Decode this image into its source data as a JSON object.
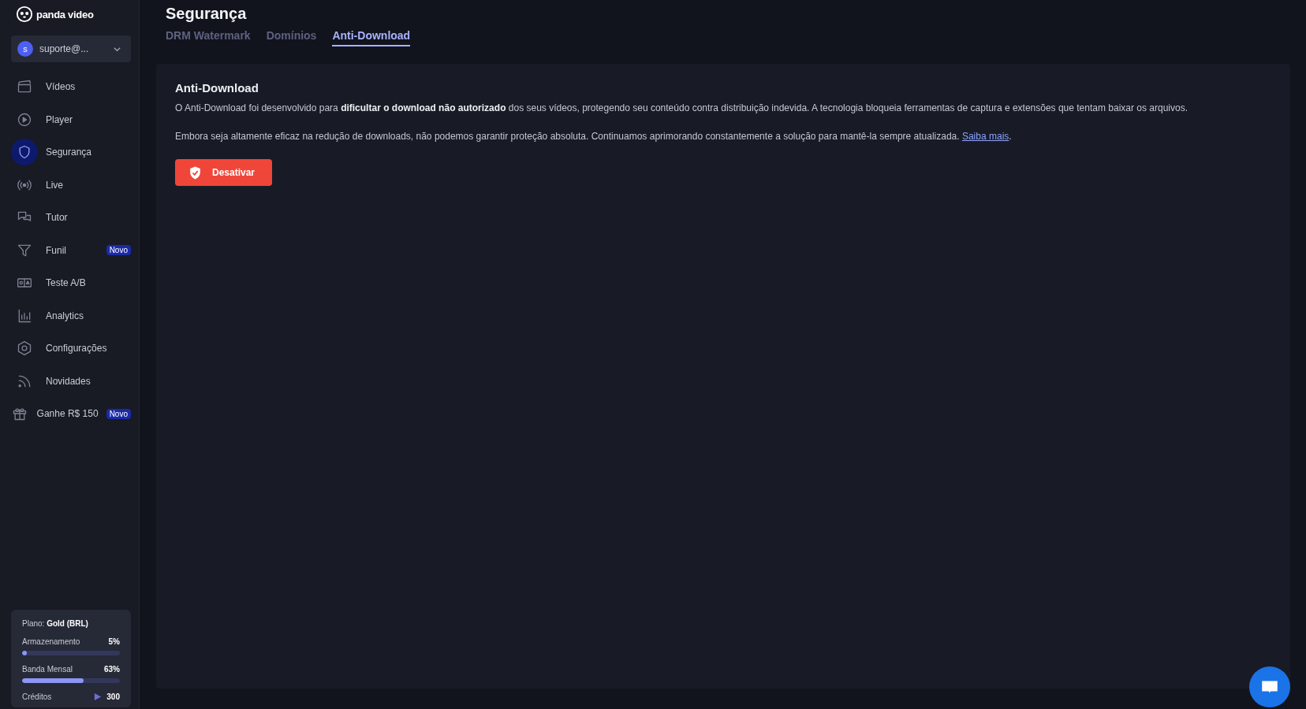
{
  "brand": {
    "name": "panda video"
  },
  "account": {
    "initial": "s",
    "email": "suporte@..."
  },
  "nav": [
    {
      "label": "Vídeos",
      "selected": false
    },
    {
      "label": "Player",
      "selected": false
    },
    {
      "label": "Segurança",
      "selected": true
    },
    {
      "label": "Live",
      "selected": false
    },
    {
      "label": "Tutor",
      "selected": false
    },
    {
      "label": "Funil",
      "selected": false,
      "badge": "Novo"
    },
    {
      "label": "Teste A/B",
      "selected": false
    },
    {
      "label": "Analytics",
      "selected": false
    },
    {
      "label": "Configurações",
      "selected": false
    },
    {
      "label": "Novidades",
      "selected": false
    },
    {
      "label": "Ganhe R$ 150",
      "selected": false,
      "badge": "Novo"
    }
  ],
  "plan": {
    "label": "Plano:",
    "name": "Gold (BRL)",
    "meters": [
      {
        "name": "Armazenamento",
        "reading": "5%",
        "level": 0.05
      },
      {
        "name": "Banda Mensal",
        "reading": "63%",
        "level": 0.63
      }
    ],
    "credits_label": "Créditos",
    "credits": "300"
  },
  "page": {
    "title": "Segurança",
    "tabs": [
      {
        "label": "DRM Watermark",
        "selected": false
      },
      {
        "label": "Domínios",
        "selected": false
      },
      {
        "label": "Anti-Download",
        "selected": true
      }
    ]
  },
  "card": {
    "title": "Anti-Download",
    "paragraph_1": "O Anti-Download foi desenvolvido para **dificultar o download não autorizado** dos seus vídeos, protegendo seu conteúdo contra distribuição indevida. A tecnologia bloqueia ferramentas de captura e extensões que tentam baixar os arquivos.",
    "paragraph_2": "Embora seja altamente eficaz na redução de downloads, não podemos garantir proteção absoluta. Continuamos aprimorando constantemente a solução para mantê-la sempre atualizada.",
    "link": "Saiba mais",
    "link_suffix": ".",
    "button": "Desativar"
  }
}
